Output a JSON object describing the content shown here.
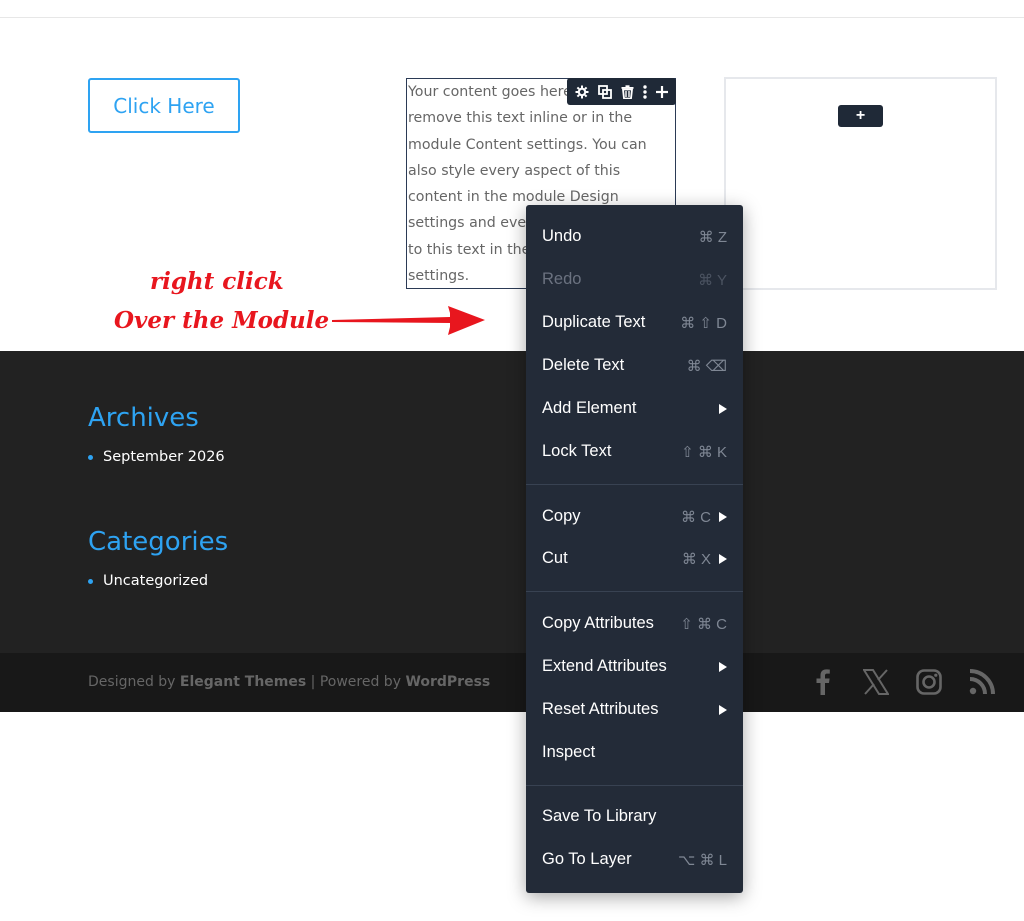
{
  "content": {
    "button_label": "Click Here",
    "text_body": "Your content goes here. Edit or remove this text inline or in the module Content settings. You can also style every aspect of this content in the module Design settings and even apply custom CSS to this text in the module Advanced settings."
  },
  "toolbar": {
    "icons": [
      "gear-icon",
      "duplicate-icon",
      "trash-icon",
      "more-vertical-icon",
      "plus-icon"
    ],
    "settings": "⚙",
    "duplicate": "⧉",
    "delete": "🗑",
    "more": "⋮",
    "add": "+"
  },
  "empty_column": {
    "add_label": "+"
  },
  "annotation": {
    "line1": "right click",
    "line2": "Over the Module",
    "color": "#e8161e"
  },
  "footer": {
    "archives_title": "Archives",
    "archives_items": [
      "September 2026"
    ],
    "categories_title": "Categories",
    "categories_items": [
      "Uncategorized"
    ],
    "credits_prefix": "Designed by ",
    "credits_theme": "Elegant Themes",
    "credits_mid": " | Powered by ",
    "credits_cms": "WordPress",
    "social": [
      "facebook-icon",
      "x-icon",
      "instagram-icon",
      "rss-icon"
    ]
  },
  "context_menu": {
    "items": [
      {
        "label": "Undo",
        "shortcut": "⌘ Z"
      },
      {
        "label": "Redo",
        "shortcut": "⌘ Y",
        "disabled": true
      },
      {
        "label": "Duplicate Text",
        "shortcut": "⌘ ⇧ D"
      },
      {
        "label": "Delete Text",
        "shortcut": "⌘ ⌫"
      },
      {
        "label": "Add Element",
        "submenu": true
      },
      {
        "label": "Lock Text",
        "shortcut": "⇧ ⌘ K"
      },
      {
        "label": "Copy",
        "shortcut": "⌘ C",
        "submenu": true
      },
      {
        "label": "Cut",
        "shortcut": "⌘ X",
        "submenu": true
      },
      {
        "label": "Copy Attributes",
        "shortcut": "⇧ ⌘ C"
      },
      {
        "label": "Extend Attributes",
        "submenu": true
      },
      {
        "label": "Reset Attributes",
        "submenu": true
      },
      {
        "label": "Inspect"
      },
      {
        "label": "Save To Library"
      },
      {
        "label": "Go To Layer",
        "shortcut": "⌥ ⌘ L"
      }
    ]
  },
  "colors": {
    "accent": "#2ea3f2",
    "menu_bg": "#232b38",
    "footer_bg": "#222222",
    "bottom_bar_bg": "#181818"
  }
}
